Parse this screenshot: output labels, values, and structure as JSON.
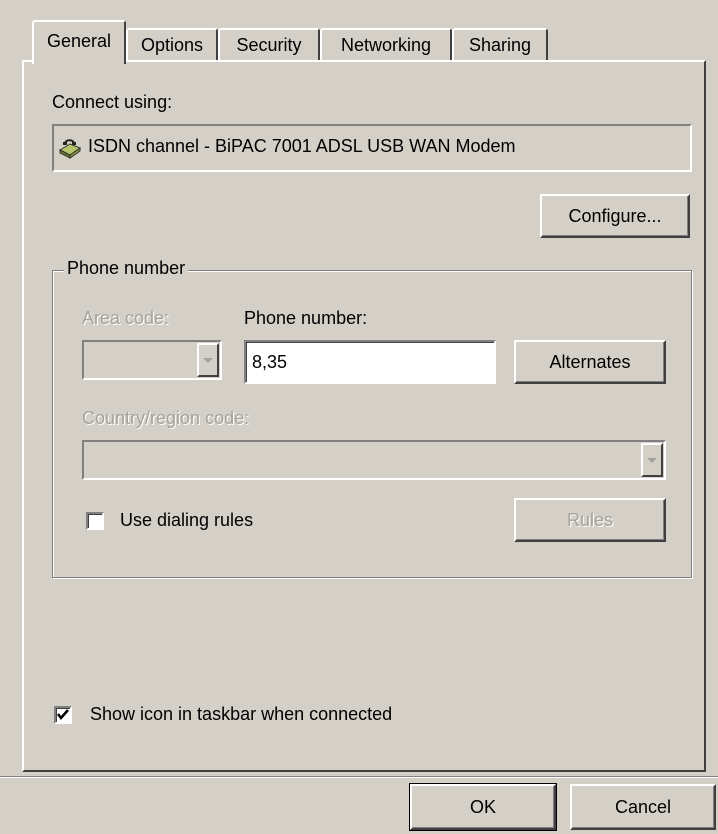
{
  "tabs": [
    {
      "label": "General",
      "active": true
    },
    {
      "label": "Options",
      "active": false
    },
    {
      "label": "Security",
      "active": false
    },
    {
      "label": "Networking",
      "active": false
    },
    {
      "label": "Sharing",
      "active": false
    }
  ],
  "general": {
    "connect_using_label": "Connect using:",
    "device_name": "ISDN  channel - BiPAC 7001 ADSL USB WAN Modem",
    "device_icon": "modem-icon",
    "configure_label": "Configure...",
    "phone_group": {
      "legend": "Phone number",
      "area_code_label": "Area code:",
      "area_code_value": "",
      "phone_number_label": "Phone number:",
      "phone_number_value": "8,35",
      "alternates_label": "Alternates",
      "country_code_label": "Country/region code:",
      "country_code_value": "",
      "use_dialing_rules_label": "Use dialing rules",
      "use_dialing_rules_checked": false,
      "rules_label": "Rules"
    },
    "show_icon_label": "Show icon in taskbar when connected",
    "show_icon_checked": true
  },
  "footer": {
    "ok_label": "OK",
    "cancel_label": "Cancel"
  },
  "colors": {
    "face": "#d4d0c8",
    "shadow": "#808080",
    "highlight": "#ffffff",
    "disabled_text": "#a5a29b"
  }
}
